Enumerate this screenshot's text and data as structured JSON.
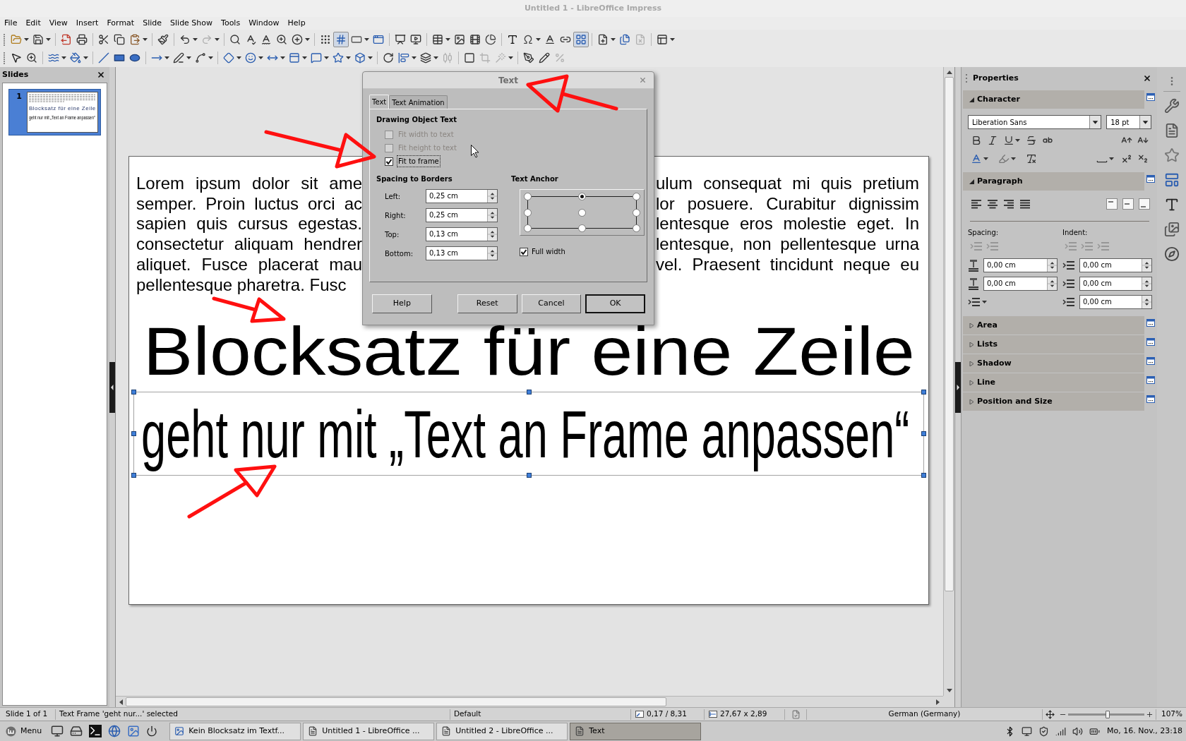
{
  "window": {
    "title": "Untitled 1 - LibreOffice Impress"
  },
  "menu": [
    "File",
    "Edit",
    "View",
    "Insert",
    "Format",
    "Slide",
    "Slide Show",
    "Tools",
    "Window",
    "Help"
  ],
  "toolbars": [
    {
      "buttons": [
        {
          "on": false,
          "disabled": false
        },
        {
          "on": false,
          "disabled": false
        },
        {
          "on": false,
          "disabled": false
        },
        {
          "on": false,
          "disabled": false
        },
        {
          "on": false,
          "disabled": false
        },
        {
          "on": false,
          "disabled": false
        },
        {
          "on": false,
          "disabled": false
        },
        {
          "on": false,
          "disabled": false
        },
        {
          "on": false,
          "disabled": false
        },
        {
          "on": false,
          "disabled": true
        },
        {
          "on": false,
          "disabled": false
        },
        {
          "on": false,
          "disabled": false
        },
        {
          "on": false,
          "disabled": false
        },
        {
          "on": false,
          "disabled": false
        },
        {
          "on": false,
          "disabled": false
        },
        {
          "on": false,
          "disabled": false
        },
        {
          "on": true,
          "disabled": false
        },
        {
          "on": false,
          "disabled": false
        },
        {
          "on": false,
          "disabled": false
        },
        {
          "on": false,
          "disabled": false
        },
        {
          "on": false,
          "disabled": false
        },
        {
          "on": false,
          "disabled": false
        },
        {
          "on": false,
          "disabled": false
        },
        {
          "on": false,
          "disabled": false
        },
        {
          "on": false,
          "disabled": false
        },
        {
          "on": false,
          "disabled": false
        },
        {
          "on": false,
          "disabled": false
        },
        {
          "on": false,
          "disabled": false
        },
        {
          "on": false,
          "disabled": false
        },
        {
          "on": true,
          "disabled": false
        },
        {
          "on": false,
          "disabled": false
        },
        {
          "on": false,
          "disabled": false
        },
        {
          "on": false,
          "disabled": true
        },
        {
          "on": false,
          "disabled": false
        }
      ]
    },
    {
      "buttons": [
        {
          "on": false,
          "disabled": false
        },
        {
          "on": false,
          "disabled": false
        },
        {
          "on": false,
          "disabled": false
        },
        {
          "on": false,
          "disabled": false
        },
        {
          "on": false,
          "disabled": false
        },
        {
          "on": false,
          "disabled": false
        },
        {
          "on": false,
          "disabled": false
        },
        {
          "on": false,
          "disabled": false
        },
        {
          "on": false,
          "disabled": false
        },
        {
          "on": false,
          "disabled": false
        },
        {
          "on": false,
          "disabled": false
        },
        {
          "on": false,
          "disabled": false
        },
        {
          "on": false,
          "disabled": false
        },
        {
          "on": false,
          "disabled": false
        },
        {
          "on": false,
          "disabled": false
        },
        {
          "on": false,
          "disabled": false
        },
        {
          "on": false,
          "disabled": false
        },
        {
          "on": false,
          "disabled": false
        },
        {
          "on": false,
          "disabled": false
        },
        {
          "on": false,
          "disabled": false
        },
        {
          "on": false,
          "disabled": true
        },
        {
          "on": false,
          "disabled": false
        },
        {
          "on": false,
          "disabled": true
        },
        {
          "on": false,
          "disabled": true
        },
        {
          "on": false,
          "disabled": false
        },
        {
          "on": false,
          "disabled": false
        },
        {
          "on": false,
          "disabled": true
        }
      ]
    }
  ],
  "slides_panel": {
    "title": "Slides",
    "slides": [
      {
        "number": "1",
        "selected": true,
        "title": "Blocksatz für eine Zeile",
        "subtitle": "geht nur mit „Text an Frame anpassen“"
      }
    ]
  },
  "slide": {
    "body_lines": [
      {
        "left": "Lorem ipsum dolor sit ame",
        "right": "ulum consequat mi quis pretium"
      },
      {
        "left": "semper. Proin luctus orci ac",
        "right": "lor posuere. Curabitur dignissim"
      },
      {
        "left": "sapien quis cursus egestas.",
        "right": "lentesque eros molestie eget. In"
      },
      {
        "left": "consectetur aliquam hendrer",
        "right": "lentesque, non pellentesque urna"
      },
      {
        "left": "aliquet. Fusce placerat mau",
        "right": "vel. Praesent tincidunt neque eu"
      },
      {
        "left": "pellentesque pharetra. Fusc"
      }
    ],
    "heading": "Blocksatz für eine Zeile",
    "text_frame": {
      "text": "geht nur mit „Text an Frame anpassen“",
      "selected": true
    }
  },
  "dialog": {
    "title": "Text",
    "tabs": [
      {
        "label": "Text",
        "selected": true
      },
      {
        "label": "Text Animation",
        "selected": false
      }
    ],
    "drawing_object_text": {
      "heading": "Drawing Object Text",
      "options": [
        {
          "label": "Fit width to text",
          "checked": false,
          "disabled": true,
          "focused": false
        },
        {
          "label": "Fit height to text",
          "checked": false,
          "disabled": true,
          "focused": false
        },
        {
          "label": "Fit to frame",
          "checked": true,
          "disabled": false,
          "focused": true
        }
      ]
    },
    "spacing_to_borders": {
      "heading": "Spacing to Borders",
      "fields": [
        {
          "label": "Left:",
          "value": "0,25 cm"
        },
        {
          "label": "Right:",
          "value": "0,25 cm"
        },
        {
          "label": "Top:",
          "value": "0,13 cm"
        },
        {
          "label": "Bottom:",
          "value": "0,13 cm"
        }
      ]
    },
    "text_anchor": {
      "heading": "Text Anchor",
      "points": [
        {
          "selected": false
        },
        {
          "selected": true
        },
        {
          "selected": false
        },
        {
          "selected": false
        },
        {
          "selected": false
        },
        {
          "selected": false
        },
        {
          "selected": false
        },
        {
          "selected": false
        },
        {
          "selected": false
        }
      ],
      "full_width": {
        "label": "Full width",
        "checked": true
      }
    },
    "buttons": [
      {
        "label": "Help",
        "default": false
      },
      {
        "label": "Reset",
        "default": false
      },
      {
        "label": "Cancel",
        "default": false
      },
      {
        "label": "OK",
        "default": true
      }
    ]
  },
  "sidebar": {
    "title": "Properties",
    "sections": [
      {
        "title": "Character",
        "expanded": true,
        "kind": "character",
        "font_name": "Liberation Sans",
        "font_size": "18 pt"
      },
      {
        "title": "Paragraph",
        "expanded": true,
        "kind": "paragraph",
        "spacing_label": "Spacing:",
        "indent_label": "Indent:",
        "spacing_buttons": [
          {
            "disabled": true
          },
          {
            "disabled": true
          }
        ],
        "indent_buttons": [
          {
            "disabled": true
          },
          {
            "disabled": true
          },
          {
            "disabled": true
          }
        ],
        "spacing_fields": [
          "0,00 cm",
          "0,00 cm"
        ],
        "indent_fields": [
          "0,00 cm",
          "0,00 cm",
          "0,00 cm"
        ]
      },
      {
        "title": "Area",
        "expanded": false
      },
      {
        "title": "Lists",
        "expanded": false
      },
      {
        "title": "Shadow",
        "expanded": false
      },
      {
        "title": "Line",
        "expanded": false
      },
      {
        "title": "Position and Size",
        "expanded": false
      }
    ]
  },
  "status_bar": {
    "slide_info": "Slide 1 of 1",
    "selection": "Text Frame 'geht nur...' selected",
    "layout": "Default",
    "position": "0,17 / 8,31",
    "size": "27,67 x 2,89",
    "language": "German (Germany)",
    "zoom": {
      "level": 0.52,
      "reading": "107%"
    }
  },
  "taskbar": {
    "menu_label": "Menu",
    "windows": [
      {
        "title": "Kein Blocksatz im Textf...",
        "selected": false
      },
      {
        "title": "Untitled 1 - LibreOffice ...",
        "selected": false
      },
      {
        "title": "Untitled 2 - LibreOffice ...",
        "selected": false
      },
      {
        "title": "Text",
        "selected": true
      }
    ],
    "clock": "Mo, 16. Nov., 23:18"
  }
}
